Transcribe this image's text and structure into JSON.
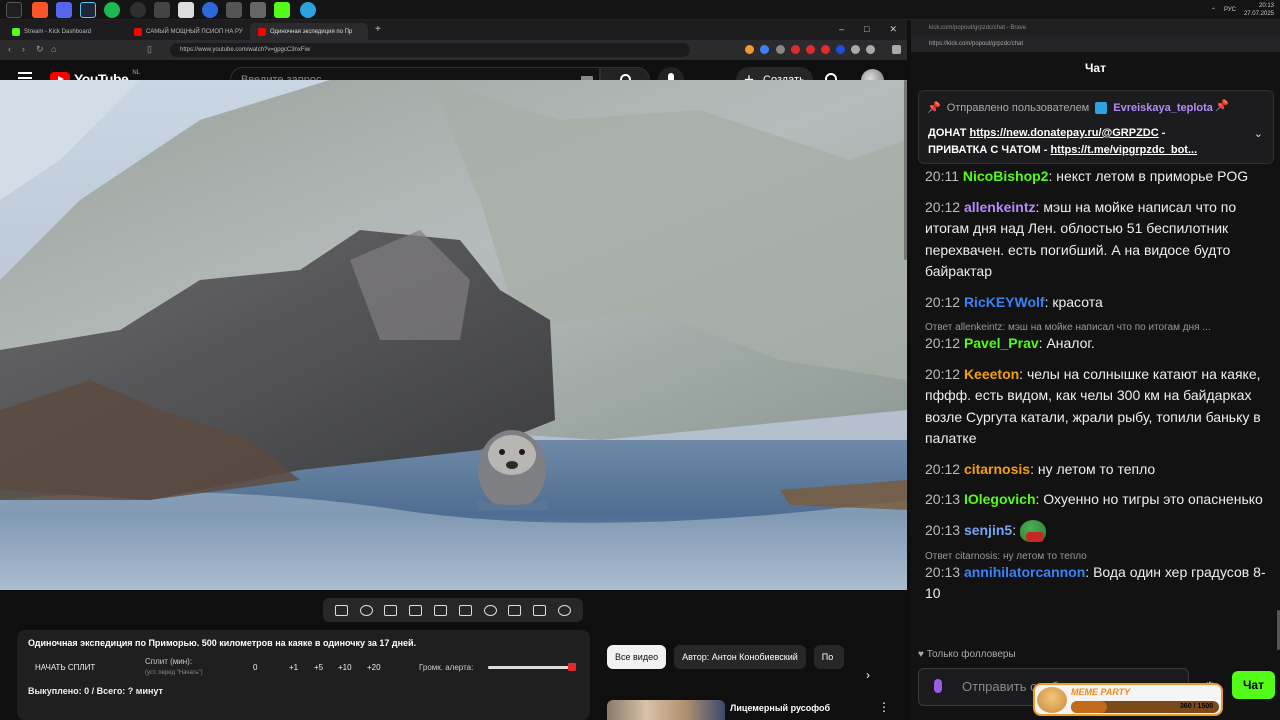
{
  "taskbar": {
    "clock_time": "20:13",
    "clock_date": "27.07.2025",
    "lang": "РУС"
  },
  "browser": {
    "tabs": [
      {
        "label": "Stream - Kick Dashboard",
        "color": "#53fc18"
      },
      {
        "label": "САМЫЙ МОЩНЫЙ ПСИОП НА РУ",
        "color": "#ff0000"
      },
      {
        "label": "Одиночная экспедиция по Пр",
        "color": "#ff0000"
      }
    ],
    "url": "https://www.youtube.com/watch?v=gpgcC3nxFiw"
  },
  "youtube": {
    "logo_text": "YouTube",
    "logo_country": "NL",
    "search_placeholder": "Введите запрос",
    "create_label": "Создать"
  },
  "panel": {
    "title": "Одиночная экспедиция по Приморью. 500 километров на каяке в одиночку за 17 дней.",
    "start_split": "НАЧАТЬ СПЛИТ",
    "split_label": "Сплит (мин):",
    "split_hint": "(уст. перед \"Начать\")",
    "split_value": "0",
    "increments": [
      "+1",
      "+5",
      "+10",
      "+20"
    ],
    "volume_label": "Громк. алерта:",
    "volume_level": 0.98,
    "bought": "Выкуплено: 0 / Всего: ? минут"
  },
  "chips": [
    "Все видео",
    "Автор: Антон Конобиевский",
    "По"
  ],
  "recommendation": {
    "title": "Лицемерный русофоб"
  },
  "chat_window": {
    "title_url": "kick.com/popout/grpzdc/chat - Brave",
    "address": "https://kick.com/popout/grpzdc/chat",
    "header": "Чат",
    "pinned_prefix": "Отправлено пользователем",
    "pinned_user": "Evreiskaya_teplota",
    "pinned_line1_pre": "ДОНАТ ",
    "pinned_link1": "https://new.donatepay.ru/@GRPZDC",
    "pinned_line1_post": " -",
    "pinned_line2_pre": "ПРИВАТКА С ЧАТОМ - ",
    "pinned_link2": "https://t.me/vipgrpzdc_bot...",
    "follow_only": "Только фолловеры",
    "input_placeholder": "Отправить сообщение",
    "send_label": "Чат"
  },
  "messages": [
    {
      "time": "20:11",
      "user": "NicoBishop2",
      "color": "#53fc18",
      "text": "некст летом в приморье POG"
    },
    {
      "time": "20:12",
      "user": "allenkeintz",
      "color": "#b58bf7",
      "text": "мэш на мойке написал что по итогам дня над Лен. облостью 51 беспилотник перехвачен. есть погибший. А на видосе будто байрактар"
    },
    {
      "time": "20:12",
      "user": "RicKEYWolf",
      "color": "#3b82f6",
      "text": "красота"
    },
    {
      "reply": "Ответ allenkeintz: мэш на мойке написал что по итогам дня ...",
      "time": "20:12",
      "user": "Pavel_Prav",
      "color": "#53fc18",
      "text": "Аналог."
    },
    {
      "time": "20:12",
      "user": "Keeeton",
      "color": "#f59e0b",
      "text": "челы на солнышке катают на каяке, пффф. есть видом, как челы 300 км на байдарках возле Сургута катали, жрали рыбу, топили баньку в палатке"
    },
    {
      "time": "20:12",
      "user": "citarnosis",
      "color": "#f59e0b",
      "text": "ну летом то тепло"
    },
    {
      "time": "20:13",
      "user": "IOlegovich",
      "color": "#53fc18",
      "text": "Охуенно но тигры это опасненько"
    },
    {
      "time": "20:13",
      "user": "senjin5",
      "color": "#7aa2f7",
      "text": ""
    },
    {
      "reply": "Ответ citarnosis: ну летом то тепло",
      "time": "20:13",
      "user": "annihilatorcannon",
      "color": "#3b82f6",
      "text": "Вода один хер градусов 8-10"
    }
  ],
  "meme_party": {
    "title": "MEME PARTY",
    "count": "360 / 1500",
    "progress": 0.24
  }
}
